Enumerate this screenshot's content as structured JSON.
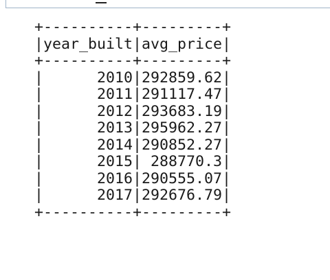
{
  "output": {
    "border_line": "+----------+---------+",
    "header_line": "|year_built|avg_price|",
    "columns": [
      "year_built",
      "avg_price"
    ],
    "rows": [
      "|      2010|292859.62|",
      "|      2011|291117.47|",
      "|      2012|293683.19|",
      "|      2013|295962.27|",
      "|      2014|290852.27|",
      "|      2015| 288770.3|",
      "|      2016|290555.07|",
      "|      2017|292676.79|"
    ],
    "values": [
      {
        "year_built": 2010,
        "avg_price": 292859.62
      },
      {
        "year_built": 2011,
        "avg_price": 291117.47
      },
      {
        "year_built": 2012,
        "avg_price": 293683.19
      },
      {
        "year_built": 2013,
        "avg_price": 295962.27
      },
      {
        "year_built": 2014,
        "avg_price": 290852.27
      },
      {
        "year_built": 2015,
        "avg_price": 288770.3
      },
      {
        "year_built": 2016,
        "avg_price": 290555.07
      },
      {
        "year_built": 2017,
        "avg_price": 292676.79
      }
    ]
  }
}
